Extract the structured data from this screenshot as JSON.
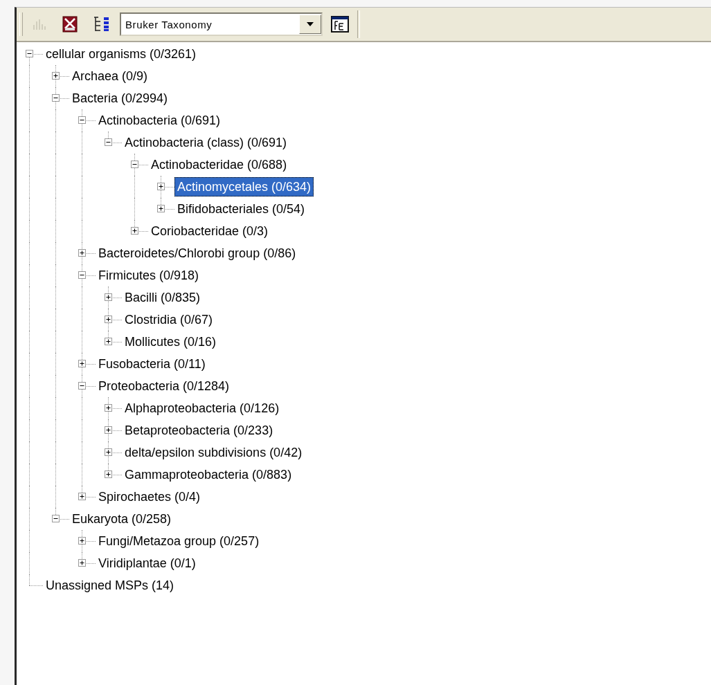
{
  "toolbar": {
    "dropdown": {
      "value": "Bruker Taxonomy"
    }
  },
  "tree": [
    {
      "label": "cellular organisms (0/3261)",
      "expanded": true,
      "selected": false,
      "children": [
        {
          "label": "Archaea (0/9)",
          "expanded": false,
          "selected": false
        },
        {
          "label": "Bacteria (0/2994)",
          "expanded": true,
          "selected": false,
          "children": [
            {
              "label": "Actinobacteria (0/691)",
              "expanded": true,
              "selected": false,
              "children": [
                {
                  "label": "Actinobacteria (class) (0/691)",
                  "expanded": true,
                  "selected": false,
                  "children": [
                    {
                      "label": "Actinobacteridae (0/688)",
                      "expanded": true,
                      "selected": false,
                      "children": [
                        {
                          "label": "Actinomycetales (0/634)",
                          "expanded": false,
                          "selected": true
                        },
                        {
                          "label": "Bifidobacteriales (0/54)",
                          "expanded": false,
                          "selected": false
                        }
                      ]
                    },
                    {
                      "label": "Coriobacteridae (0/3)",
                      "expanded": false,
                      "selected": false
                    }
                  ]
                }
              ]
            },
            {
              "label": "Bacteroidetes/Chlorobi group (0/86)",
              "expanded": false,
              "selected": false
            },
            {
              "label": "Firmicutes (0/918)",
              "expanded": true,
              "selected": false,
              "children": [
                {
                  "label": "Bacilli (0/835)",
                  "expanded": false,
                  "selected": false
                },
                {
                  "label": "Clostridia (0/67)",
                  "expanded": false,
                  "selected": false
                },
                {
                  "label": "Mollicutes (0/16)",
                  "expanded": false,
                  "selected": false
                }
              ]
            },
            {
              "label": "Fusobacteria (0/11)",
              "expanded": false,
              "selected": false
            },
            {
              "label": "Proteobacteria (0/1284)",
              "expanded": true,
              "selected": false,
              "children": [
                {
                  "label": "Alphaproteobacteria (0/126)",
                  "expanded": false,
                  "selected": false
                },
                {
                  "label": "Betaproteobacteria (0/233)",
                  "expanded": false,
                  "selected": false
                },
                {
                  "label": "delta/epsilon subdivisions (0/42)",
                  "expanded": false,
                  "selected": false
                },
                {
                  "label": "Gammaproteobacteria (0/883)",
                  "expanded": false,
                  "selected": false
                }
              ]
            },
            {
              "label": "Spirochaetes (0/4)",
              "expanded": false,
              "selected": false
            }
          ]
        },
        {
          "label": "Eukaryota (0/258)",
          "expanded": true,
          "selected": false,
          "children": [
            {
              "label": "Fungi/Metazoa group (0/257)",
              "expanded": false,
              "selected": false
            },
            {
              "label": "Viridiplantae (0/1)",
              "expanded": false,
              "selected": false
            }
          ]
        }
      ]
    },
    {
      "label": "Unassigned MSPs (14)",
      "selected": false
    }
  ]
}
